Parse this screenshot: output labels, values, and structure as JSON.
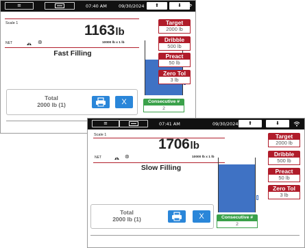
{
  "screens": [
    {
      "status_bar": {
        "time": "07:40 AM",
        "date": "09/30/2024"
      },
      "scale_name": "Scale 1",
      "weight": {
        "value": "1163",
        "unit": "lb"
      },
      "net_label": "NET",
      "capacity": "10000 lb x 1 lb",
      "state": "Fast Filling",
      "fill_level": 0.65,
      "parameters": [
        {
          "label": "Target",
          "value": "2000 lb"
        },
        {
          "label": "Dribble",
          "value": "500 lb"
        },
        {
          "label": "Preact",
          "value": "50 lb"
        },
        {
          "label": "Zero Tol",
          "value": "3 lb"
        }
      ],
      "consecutive": {
        "label": "Consecutive #",
        "value": "2"
      },
      "total": {
        "label": "Total",
        "value": "2000 lb  (1)"
      },
      "clear_label": "X"
    },
    {
      "status_bar": {
        "time": "07:41 AM",
        "date": "09/30/2024"
      },
      "scale_name": "Scale 1",
      "weight": {
        "value": "1706",
        "unit": "lb"
      },
      "net_label": "NET",
      "capacity": "10000 lb x 1 lb",
      "state": "Slow Filling",
      "fill_level": 0.88,
      "parameters": [
        {
          "label": "Target",
          "value": "2000 lb"
        },
        {
          "label": "Dribble",
          "value": "500 lb"
        },
        {
          "label": "Preact",
          "value": "50 lb"
        },
        {
          "label": "Zero Tol",
          "value": "3 lb"
        }
      ],
      "consecutive": {
        "label": "Consecutive #",
        "value": "2"
      },
      "total": {
        "label": "Total",
        "value": "2000 lb  (1)"
      },
      "clear_label": "X"
    }
  ],
  "icons": {
    "menu": "hamburger-menu-icon",
    "scale": "scale-select-icon",
    "up": "arrow-up-icon",
    "down": "arrow-down-icon",
    "wifi": "wifi-icon",
    "print": "printer-icon",
    "zero": "zero-center-icon",
    "motion": "motion-icon"
  },
  "colors": {
    "accent_red": "#b01c2a",
    "accent_blue": "#2a86d9",
    "accent_green": "#3aa14a",
    "tank_fill": "#3f72c4",
    "status_bar": "#111111"
  }
}
